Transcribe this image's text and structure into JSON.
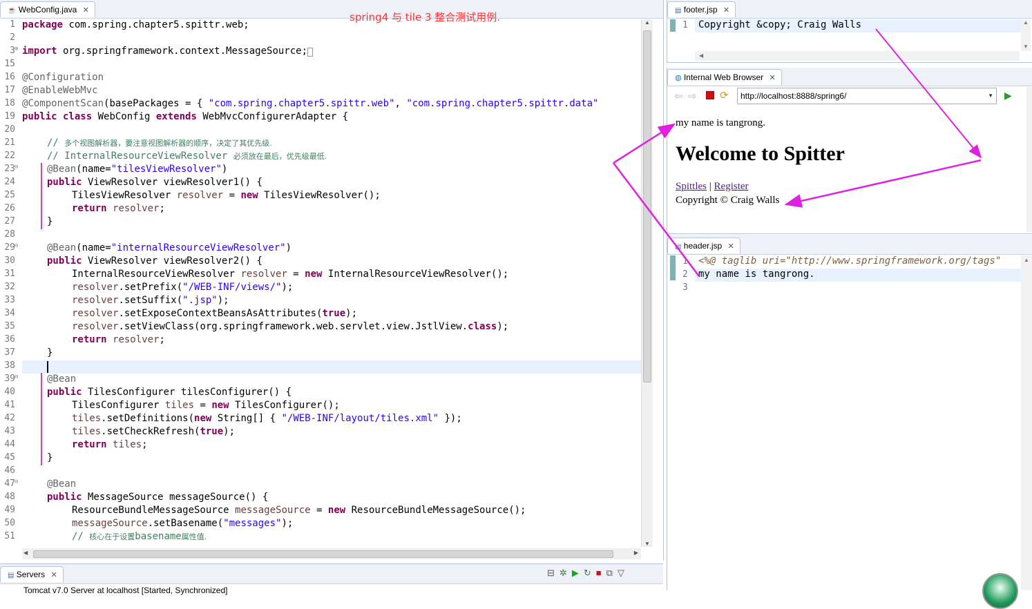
{
  "colors": {
    "keyword": "#7f0055",
    "string": "#2a00ff",
    "annotation": "#646464",
    "comment": "#3f7f5f",
    "field": "#6a3e3e",
    "arrow": "#e020e0",
    "title_red": "#ff3030"
  },
  "editor": {
    "tab_label": "WebConfig.java",
    "overlay_note": "spring4 与 tile 3 整合测试用例."
  },
  "footer_pane": {
    "tab_label": "footer.jsp",
    "line_number": "1",
    "code": "Copyright &copy; Craig Walls"
  },
  "browser": {
    "tab_label": "Internal Web Browser",
    "url": "http://localhost:8888/spring6/",
    "page": {
      "header_text": "my name is tangrong.",
      "title": "Welcome to Spitter",
      "link_spittles": "Spittles",
      "separator": "|",
      "link_register": "Register",
      "copyright": "Copyright © Craig Walls"
    }
  },
  "header_pane": {
    "tab_label": "header.jsp",
    "line1_num": "1",
    "line1": "<%@ taglib uri=\"http://www.springframework.org/tags\"",
    "line2_num": "2",
    "line2": "my name is tangrong.",
    "line3_num": "3"
  },
  "servers": {
    "tab_label": "Servers",
    "row": "Tomcat v7.0 Server at localhost  [Started, Synchronized]"
  }
}
